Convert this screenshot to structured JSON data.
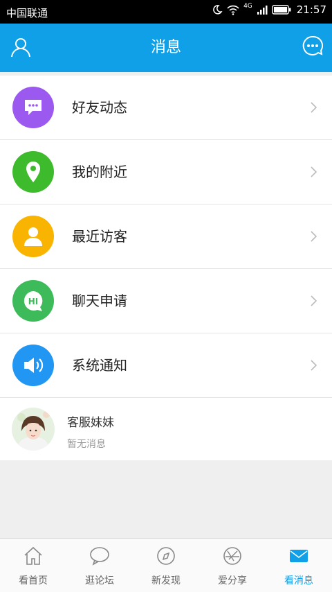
{
  "status_bar": {
    "carrier": "中国联通",
    "network": "4G",
    "time": "21:57"
  },
  "header": {
    "title": "消息"
  },
  "menu": [
    {
      "label": "好友动态",
      "icon": "chat-bubble-icon",
      "color": "#9b59f0"
    },
    {
      "label": "我的附近",
      "icon": "location-pin-icon",
      "color": "#3dbb2c"
    },
    {
      "label": "最近访客",
      "icon": "person-icon",
      "color": "#f8b400"
    },
    {
      "label": "聊天申请",
      "icon": "hi-bubble-icon",
      "color": "#3dbb5a"
    },
    {
      "label": "系统通知",
      "icon": "speaker-icon",
      "color": "#2196f3"
    }
  ],
  "contact": {
    "name": "客服妹妹",
    "preview": "暂无消息"
  },
  "tabs": [
    {
      "label": "看首页",
      "icon": "home-icon"
    },
    {
      "label": "逛论坛",
      "icon": "forum-bubble-icon"
    },
    {
      "label": "新发现",
      "icon": "compass-icon"
    },
    {
      "label": "爱分享",
      "icon": "share-aperture-icon"
    },
    {
      "label": "看消息",
      "icon": "mail-icon",
      "active": true
    }
  ],
  "colors": {
    "accent": "#0fa0e8"
  }
}
